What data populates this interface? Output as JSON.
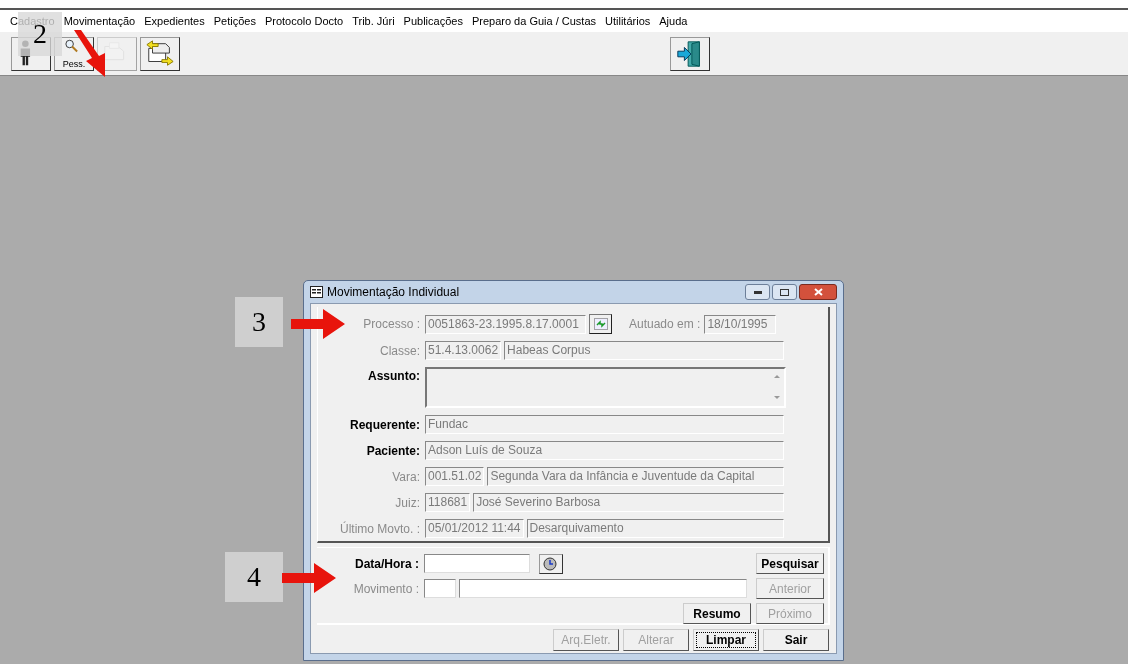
{
  "menu": [
    {
      "label": "Cadastro"
    },
    {
      "label": "Movimentação"
    },
    {
      "label": "Expedientes"
    },
    {
      "label": "Petições"
    },
    {
      "label": "Protocolo Docto"
    },
    {
      "label": "Trib. Júri"
    },
    {
      "label": "Publicações"
    },
    {
      "label": "Preparo da Guia / Custas"
    },
    {
      "label": "Utilitários"
    },
    {
      "label": "Ajuda"
    }
  ],
  "toolbar": [
    {
      "kind": "person",
      "disabled": false
    },
    {
      "kind": "search",
      "label": "Pess.",
      "disabled": false
    },
    {
      "kind": "document",
      "disabled": true
    },
    {
      "kind": "transfer",
      "disabled": false
    },
    {
      "kind": "exit",
      "disabled": false
    }
  ],
  "dialog": {
    "title": "Movimentação Individual",
    "rows": [
      {
        "kind": "process",
        "label": "Processo :",
        "enabled": false,
        "value": "0051863-23.1995.8.17.0001",
        "extra_label": "Autuado em :",
        "extra_value": "18/10/1995"
      },
      {
        "kind": "pair",
        "label": "Classe:",
        "enabled": false,
        "code": "51.4.13.0062",
        "value": "Habeas Corpus"
      },
      {
        "kind": "memo",
        "label": "Assunto:",
        "enabled": true
      },
      {
        "kind": "single",
        "label": "Requerente:",
        "enabled": true,
        "value": "Fundac"
      },
      {
        "kind": "single",
        "label": "Paciente:",
        "enabled": true,
        "value": "Adson Luís de Souza"
      },
      {
        "kind": "pair",
        "label": "Vara:",
        "enabled": false,
        "code": "001.51.02",
        "value": "Segunda Vara da Infância e Juventude da Capital"
      },
      {
        "kind": "pair",
        "label": "Juiz:",
        "enabled": false,
        "code": "118681",
        "value": "José Severino Barbosa"
      },
      {
        "kind": "pair",
        "label": "Último Movto. :",
        "enabled": false,
        "code": "05/01/2012 11:44",
        "value": "Desarquivamento"
      }
    ],
    "search_rows": [
      {
        "kind": "datetime",
        "label": "Data/Hora :",
        "enabled": true
      },
      {
        "kind": "movement",
        "label": "Movimento :",
        "enabled": false
      }
    ],
    "search_buttons": [
      {
        "label": "Pesquisar",
        "disabled": false
      },
      {
        "label": "Anterior",
        "disabled": true
      },
      {
        "label": "Resumo",
        "disabled": false
      },
      {
        "label": "Próximo",
        "disabled": true
      }
    ],
    "footer_buttons": [
      {
        "label": "Arq.Eletr.",
        "disabled": true,
        "focused": false
      },
      {
        "label": "Alterar",
        "disabled": true,
        "focused": false
      },
      {
        "label": "Limpar",
        "disabled": false,
        "focused": true
      },
      {
        "label": "Sair",
        "disabled": false,
        "focused": false
      }
    ]
  },
  "annotations": [
    {
      "label": "2"
    },
    {
      "label": "3"
    },
    {
      "label": "4"
    }
  ]
}
